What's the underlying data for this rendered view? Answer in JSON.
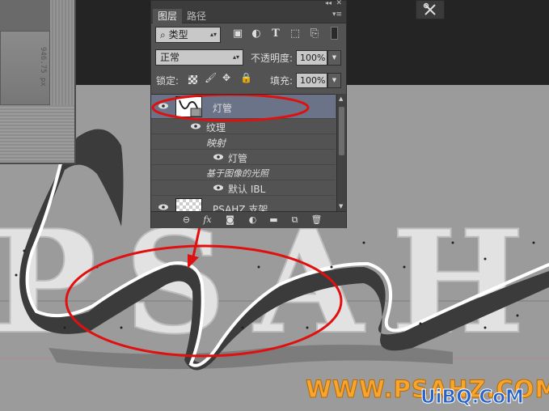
{
  "panel": {
    "tabs": [
      {
        "label": "图层"
      },
      {
        "label": "路径"
      }
    ],
    "filter": {
      "label": "类型"
    },
    "blend_mode": {
      "value": "正常"
    },
    "opacity": {
      "label": "不透明度:",
      "value": "100%"
    },
    "lock": {
      "label": "锁定:"
    },
    "fill": {
      "label": "填充:",
      "value": "100%"
    },
    "layers": {
      "selected": {
        "name": "灯管"
      },
      "sub1": {
        "name": "纹理"
      },
      "sub2": {
        "name": "映射"
      },
      "sub3": {
        "name": "灯管"
      },
      "sub4": {
        "name": "基于图像的光照"
      },
      "sub5": {
        "name": "默认 IBL"
      },
      "next": {
        "name": "PSAHZ 支架"
      }
    }
  },
  "document": {
    "size_label": "946.75 px"
  },
  "canvas": {
    "text": "PSAHZ"
  },
  "watermark": {
    "site": "WWW.PSAHZ.COM",
    "logo": "UiBQ.CoM"
  },
  "colors": {
    "annotation_red": "#e01010",
    "watermark_orange": "#f7a531",
    "selection_blue": "#6b7388"
  }
}
